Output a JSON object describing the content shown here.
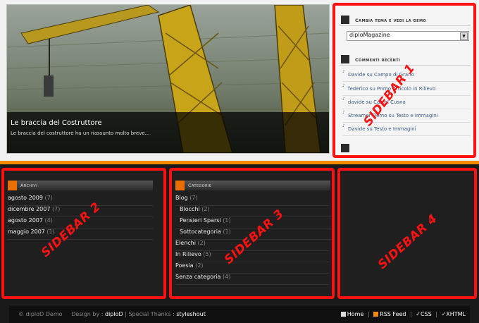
{
  "featured": {
    "title": "Le braccia del Costruttore",
    "excerpt": "Le braccia del costruttore ha un riassunto molto breve..."
  },
  "sidebar1": {
    "theme_heading": "Cambia tema e vedi la demo",
    "theme_selected": "diploMagazine",
    "comments_heading": "Commenti recenti",
    "comments": [
      "Davide su Campo di Grano",
      "federico su Primo Articolo in Rilievo",
      "davide su Castel Cusna",
      "Streamer Demo su Testo e Immagini",
      "Davide su Testo e Immagini"
    ]
  },
  "archivi": {
    "heading": "Archivi",
    "items": [
      {
        "label": "agosto 2009",
        "count": "(7)"
      },
      {
        "label": "dicembre 2007",
        "count": "(7)"
      },
      {
        "label": "agosto 2007",
        "count": "(4)"
      },
      {
        "label": "maggio 2007",
        "count": "(1)"
      }
    ]
  },
  "categorie": {
    "heading": "Categorie",
    "items": [
      {
        "label": "Blog",
        "count": "(7)",
        "indent": false
      },
      {
        "label": "Blocchi",
        "count": "(2)",
        "indent": true
      },
      {
        "label": "Pensieri Sparsi",
        "count": "(1)",
        "indent": true
      },
      {
        "label": "Sottocategoria",
        "count": "(1)",
        "indent": true
      },
      {
        "label": "Elenchi",
        "count": "(2)",
        "indent": false
      },
      {
        "label": "In Rilievo",
        "count": "(5)",
        "indent": false
      },
      {
        "label": "Poesia",
        "count": "(2)",
        "indent": false
      },
      {
        "label": "Senza categoria",
        "count": "(4)",
        "indent": false
      }
    ]
  },
  "watermarks": [
    "SIDEBAR 1",
    "SIDEBAR 2",
    "SIDEBAR 3",
    "SIDEBAR 4"
  ],
  "footer": {
    "copyright": "© diploD Demo",
    "design_by": "Design by :",
    "designer": "diploD",
    "thanks": "| Special Thanks :",
    "thanks_name": "styleshout",
    "links": [
      "Home",
      "RSS Feed",
      "CSS",
      "XHTML"
    ]
  },
  "colors": {
    "accent": "#f28a00",
    "highlight": "#ff1111"
  }
}
